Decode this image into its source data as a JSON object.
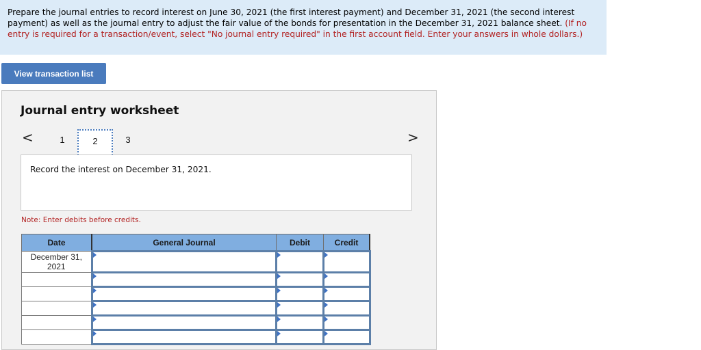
{
  "instructions": {
    "text_black": "Prepare the journal entries to record interest on June 30, 2021 (the first interest payment) and December 31, 2021 (the second interest payment) as well as the journal entry to adjust the fair value of the bonds for presentation in the December 31, 2021 balance sheet.",
    "text_red": "(If no entry is required for a transaction/event, select \"No journal entry required\" in the first account field. Enter your answers in whole dollars.)"
  },
  "view_transaction_button": "View transaction list",
  "worksheet": {
    "title": "Journal entry worksheet",
    "nav_prev": "<",
    "nav_next": ">",
    "pages": [
      "1",
      "2",
      "3"
    ],
    "active_page": "2",
    "prompt": "Record the interest on December 31, 2021.",
    "note": "Note: Enter debits before credits."
  },
  "journal_table": {
    "headers": [
      "Date",
      "General Journal",
      "Debit",
      "Credit"
    ],
    "rows": [
      {
        "date": "December 31, 2021",
        "account": "",
        "debit": "",
        "credit": ""
      },
      {
        "date": "",
        "account": "",
        "debit": "",
        "credit": ""
      },
      {
        "date": "",
        "account": "",
        "debit": "",
        "credit": ""
      },
      {
        "date": "",
        "account": "",
        "debit": "",
        "credit": ""
      },
      {
        "date": "",
        "account": "",
        "debit": "",
        "credit": ""
      },
      {
        "date": "",
        "account": "",
        "debit": "",
        "credit": ""
      }
    ]
  },
  "colors": {
    "instructions_bg": "#dcebf8",
    "accent_red": "#b22222",
    "button_blue": "#4a7bbd",
    "table_header_bg": "#80aee0",
    "cell_border": "#5c7fa8"
  }
}
